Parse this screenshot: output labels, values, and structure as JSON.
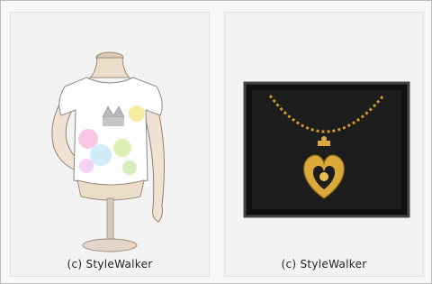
{
  "items": [
    {
      "name": "tshirt-on-mannequin",
      "caption": "(c) StyleWalker"
    },
    {
      "name": "heart-crown-necklace",
      "caption": "(c) StyleWalker"
    }
  ],
  "colors": {
    "background": "#f3f3f3",
    "box": "#1a1a1a",
    "gold": "#c9992b"
  }
}
